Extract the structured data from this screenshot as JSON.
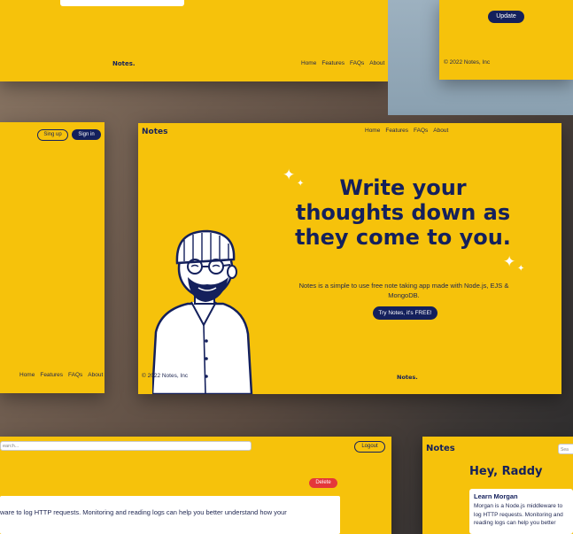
{
  "top_left_panel": {
    "logo": "Notes.",
    "nav": [
      "Home",
      "Features",
      "FAQs",
      "About"
    ]
  },
  "top_right_panel": {
    "update_button": "Update",
    "copyright": "© 2022 Notes, Inc"
  },
  "left_panel": {
    "signup_button": "Sing up",
    "signin_button": "Sign in",
    "nav": [
      "Home",
      "Features",
      "FAQs",
      "About"
    ]
  },
  "hero_panel": {
    "logo": "Notes",
    "nav": [
      "Home",
      "Features",
      "FAQs",
      "About"
    ],
    "title": "Write your thoughts down as they come to you.",
    "subtitle": "Notes is a simple to use free note taking app made with Node.js, EJS & MongoDB.",
    "cta_button": "Try Notes, it's FREE!",
    "copyright": "© 2022 Notes, Inc",
    "footer_logo": "Notes."
  },
  "bottom_left_panel": {
    "search_placeholder": "earch...",
    "logout_button": "Logout",
    "delete_button": "Delete",
    "note_body": "ware to log HTTP requests. Monitoring and reading logs can help you better understand how your"
  },
  "bottom_right_panel": {
    "logo": "Notes",
    "search_placeholder": "Sea",
    "greeting": "Hey, Raddy",
    "card_title": "Learn Morgan",
    "card_body": "Morgan is a Node.js middleware to log HTTP requests. Monitoring and reading logs can help you better"
  },
  "colors": {
    "accent": "#f6c20b",
    "navy": "#14205c",
    "danger": "#e4373a"
  }
}
